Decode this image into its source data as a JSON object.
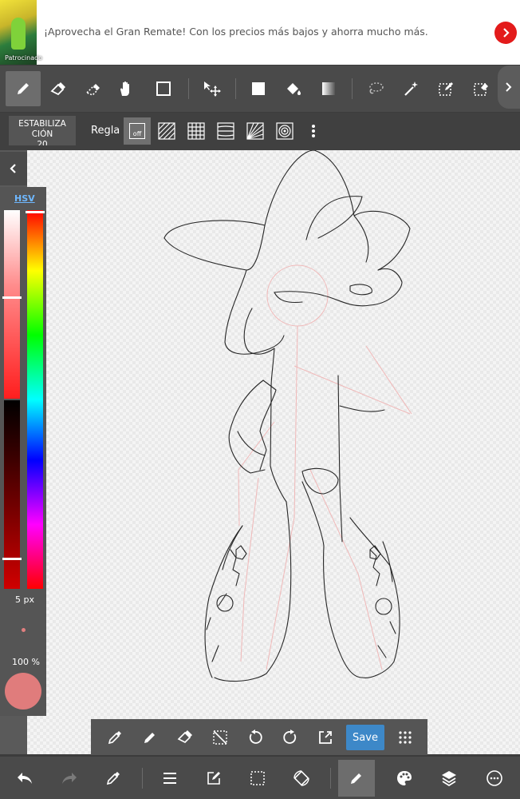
{
  "ad": {
    "text": "¡Aprovecha el Gran Remate! Con los precios más bajos y ahorra mucho más.",
    "sponsor_label": "Patrocinado"
  },
  "toolbar": {
    "tools": [
      {
        "name": "brush-tool",
        "icon": "pencil-icon",
        "active": true
      },
      {
        "name": "eraser-tool",
        "icon": "eraser-icon"
      },
      {
        "name": "blur-eraser-tool",
        "icon": "soft-eraser-icon"
      },
      {
        "name": "hand-tool",
        "icon": "hand-icon"
      },
      {
        "name": "shape-tool",
        "icon": "square-outline-icon"
      },
      {
        "name": "move-tool",
        "icon": "move-icon"
      },
      {
        "name": "fill-square-tool",
        "icon": "filled-square-icon"
      },
      {
        "name": "bucket-tool",
        "icon": "bucket-icon"
      },
      {
        "name": "gradient-tool",
        "icon": "gradient-icon"
      },
      {
        "name": "lasso-tool",
        "icon": "lasso-icon"
      },
      {
        "name": "magic-wand-tool",
        "icon": "magic-wand-icon"
      },
      {
        "name": "select-pen-tool",
        "icon": "select-pen-icon"
      },
      {
        "name": "select-eraser-tool",
        "icon": "select-eraser-icon"
      }
    ]
  },
  "ruler_bar": {
    "stabilizer_label": "ESTABILIZACIÓN",
    "stabilizer_value": "20",
    "ruler_label": "Regla",
    "off_label": "off"
  },
  "color_panel": {
    "mode_label": "HSV",
    "brush_size": "5 px",
    "opacity": "100 %",
    "current_color": "#e07c7c"
  },
  "float_bar": {
    "save_label": "Save"
  },
  "colors": {
    "toolbar_bg": "#4a4a4a",
    "accent": "#3d88c8",
    "ad_arrow": "#e31b1b"
  }
}
